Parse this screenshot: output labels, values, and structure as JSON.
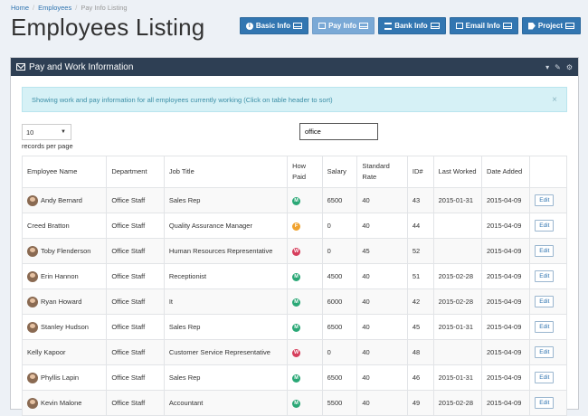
{
  "breadcrumb": [
    "Home",
    "Employees",
    "Pay Info Listing"
  ],
  "page": {
    "title": "Employees Listing"
  },
  "top_buttons": [
    {
      "label": "Basic Info",
      "icon": "info-icon",
      "active": false
    },
    {
      "label": "Pay Info",
      "icon": "envelope-icon",
      "active": true
    },
    {
      "label": "Bank Info",
      "icon": "bank-icon",
      "active": false
    },
    {
      "label": "Email Info",
      "icon": "envelope-icon",
      "active": false
    },
    {
      "label": "Project",
      "icon": "tag-icon",
      "active": false
    }
  ],
  "widget": {
    "title": "Pay and Work Information",
    "tools": [
      "▾",
      "✎",
      "⚙"
    ]
  },
  "alert": {
    "text": "Showing work and pay information for all employees currently working (Click on table header to sort)",
    "close": "×"
  },
  "length": {
    "value": "10",
    "label": "records per page"
  },
  "search": {
    "value": "office"
  },
  "columns": [
    "Employee Name",
    "Department",
    "Job Title",
    "How Paid",
    "Salary",
    "Standard Rate",
    "ID#",
    "Last Worked",
    "Date Added",
    ""
  ],
  "rows": [
    {
      "name": "Andy Bernard",
      "avatar": true,
      "dept": "Office Staff",
      "job": "Sales Rep",
      "paid": "M",
      "salary": "6500",
      "rate": "40",
      "id": "43",
      "last": "2015-01-31",
      "added": "2015-04-09",
      "action": "Edit"
    },
    {
      "name": "Creed Bratton",
      "avatar": false,
      "dept": "Office Staff",
      "job": "Quality Assurance Manager",
      "paid": "F",
      "salary": "0",
      "rate": "40",
      "id": "44",
      "last": "",
      "added": "2015-04-09",
      "action": "Edit"
    },
    {
      "name": "Toby Flenderson",
      "avatar": true,
      "dept": "Office Staff",
      "job": "Human Resources Representative",
      "paid": "W",
      "salary": "0",
      "rate": "45",
      "id": "52",
      "last": "",
      "added": "2015-04-09",
      "action": "Edit"
    },
    {
      "name": "Erin Hannon",
      "avatar": true,
      "dept": "Office Staff",
      "job": "Receptionist",
      "paid": "M",
      "salary": "4500",
      "rate": "40",
      "id": "51",
      "last": "2015-02-28",
      "added": "2015-04-09",
      "action": "Edit"
    },
    {
      "name": "Ryan Howard",
      "avatar": true,
      "dept": "Office Staff",
      "job": "It",
      "paid": "M",
      "salary": "6000",
      "rate": "40",
      "id": "42",
      "last": "2015-02-28",
      "added": "2015-04-09",
      "action": "Edit"
    },
    {
      "name": "Stanley Hudson",
      "avatar": true,
      "dept": "Office Staff",
      "job": "Sales Rep",
      "paid": "M",
      "salary": "6500",
      "rate": "40",
      "id": "45",
      "last": "2015-01-31",
      "added": "2015-04-09",
      "action": "Edit"
    },
    {
      "name": "Kelly Kapoor",
      "avatar": false,
      "dept": "Office Staff",
      "job": "Customer Service Representative",
      "paid": "W",
      "salary": "0",
      "rate": "40",
      "id": "48",
      "last": "",
      "added": "2015-04-09",
      "action": "Edit"
    },
    {
      "name": "Phyllis Lapin",
      "avatar": true,
      "dept": "Office Staff",
      "job": "Sales Rep",
      "paid": "M",
      "salary": "6500",
      "rate": "40",
      "id": "46",
      "last": "2015-01-31",
      "added": "2015-04-09",
      "action": "Edit"
    },
    {
      "name": "Kevin Malone",
      "avatar": true,
      "dept": "Office Staff",
      "job": "Accountant",
      "paid": "M",
      "salary": "5500",
      "rate": "40",
      "id": "49",
      "last": "2015-02-28",
      "added": "2015-04-09",
      "action": "Edit"
    }
  ],
  "paid_colors": {
    "M": "#2aa876",
    "F": "#f0a22e",
    "W": "#d63e5c"
  }
}
